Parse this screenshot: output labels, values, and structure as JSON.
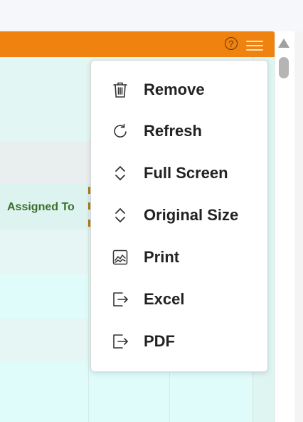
{
  "colors": {
    "header_orange": "#f0820f",
    "grid_teal": "#dff5f2",
    "grid_text_green": "#3c6e2a",
    "menu_text": "#222222"
  },
  "panel": {
    "help_icon": "?",
    "help_icon_name": "help-circle-icon",
    "menu_icon_name": "hamburger-icon"
  },
  "grid": {
    "column_header": "Assigned To"
  },
  "menu": {
    "items": [
      {
        "label": "Remove",
        "icon": "trash-icon"
      },
      {
        "label": "Refresh",
        "icon": "refresh-icon"
      },
      {
        "label": "Full Screen",
        "icon": "expand-icon"
      },
      {
        "label": "Original Size",
        "icon": "collapse-icon"
      },
      {
        "label": "Print",
        "icon": "print-chart-icon"
      },
      {
        "label": "Excel",
        "icon": "export-icon"
      },
      {
        "label": "PDF",
        "icon": "export-icon"
      }
    ]
  }
}
